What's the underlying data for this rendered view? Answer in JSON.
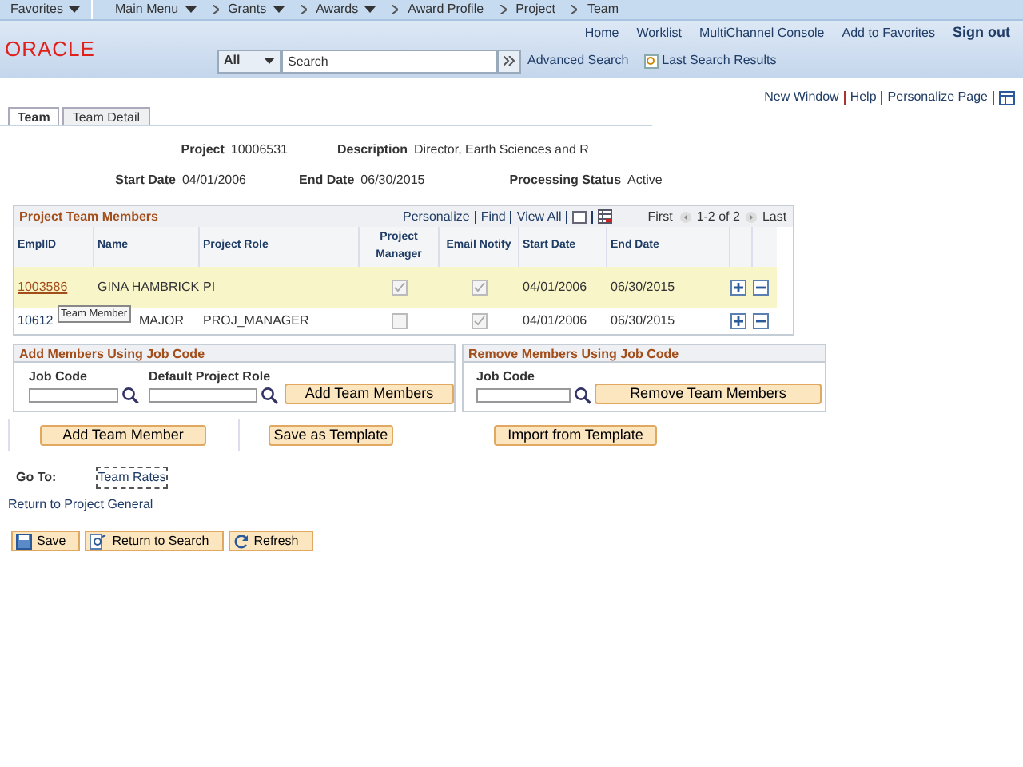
{
  "nav": {
    "items": [
      {
        "label": "Favorites",
        "dropdown": true
      },
      {
        "label": "Main Menu",
        "dropdown": true
      },
      {
        "label": "Grants",
        "dropdown": true
      },
      {
        "label": "Awards",
        "dropdown": true
      },
      {
        "label": "Award Profile",
        "dropdown": false
      },
      {
        "label": "Project",
        "dropdown": false
      },
      {
        "label": "Team",
        "dropdown": false
      }
    ]
  },
  "header": {
    "logo": "ORACLE",
    "links": [
      "Home",
      "Worklist",
      "MultiChannel Console",
      "Add to Favorites"
    ],
    "sign_out": "Sign out",
    "search_scope": "All",
    "search_placeholder": "Search",
    "advanced_search": "Advanced Search",
    "last_results": "Last Search Results"
  },
  "page_links": [
    "New Window",
    "Help",
    "Personalize Page"
  ],
  "tabs": [
    {
      "label": "Team",
      "selected": true
    },
    {
      "label": "Team Detail",
      "selected": false
    }
  ],
  "fields": [
    {
      "label": "Project",
      "value": "10006531"
    },
    {
      "label": "Description",
      "value": "Director, Earth Sciences and R"
    },
    {
      "label": "Start Date",
      "value": "04/01/2006"
    },
    {
      "label": "End Date",
      "value": "06/30/2015"
    },
    {
      "label": "Processing Status",
      "value": "Active"
    }
  ],
  "grid": {
    "title": "Project Team Members",
    "tools": [
      "Personalize",
      "Find",
      "View All"
    ],
    "first": "First",
    "range": "1-2 of 2",
    "last": "Last",
    "columns": [
      "EmplID",
      "Name",
      "Project Role",
      "Project Manager",
      "Email Notify",
      "Start Date",
      "End Date"
    ],
    "rows": [
      {
        "emplid": "1003586",
        "name": "GINA HAMBRICK",
        "role": "PI",
        "manager": true,
        "email": true,
        "start": "04/01/2006",
        "end": "06/30/2015",
        "selected": true
      },
      {
        "emplid": "10612",
        "name": "MAJOR",
        "role": "PROJ_MANAGER",
        "manager": false,
        "email": true,
        "start": "04/01/2006",
        "end": "06/30/2015",
        "selected": false
      }
    ],
    "tooltip": "Team Member"
  },
  "add_box": {
    "title": "Add Members Using Job Code",
    "job_label": "Job Code",
    "role_label": "Default Project Role",
    "button": "Add Team Members"
  },
  "remove_box": {
    "title": "Remove Members Using Job Code",
    "job_label": "Job Code",
    "button": "Remove Team Members"
  },
  "actions": [
    "Add Team Member",
    "Save as Template",
    "Import from Template"
  ],
  "goto": {
    "label": "Go To:",
    "link": "Team Rates"
  },
  "return_link": "Return to Project General",
  "toolbar": [
    {
      "label": "Save",
      "kind": "save"
    },
    {
      "label": "Return to Search",
      "kind": "search"
    },
    {
      "label": "Refresh",
      "kind": "refresh"
    }
  ]
}
